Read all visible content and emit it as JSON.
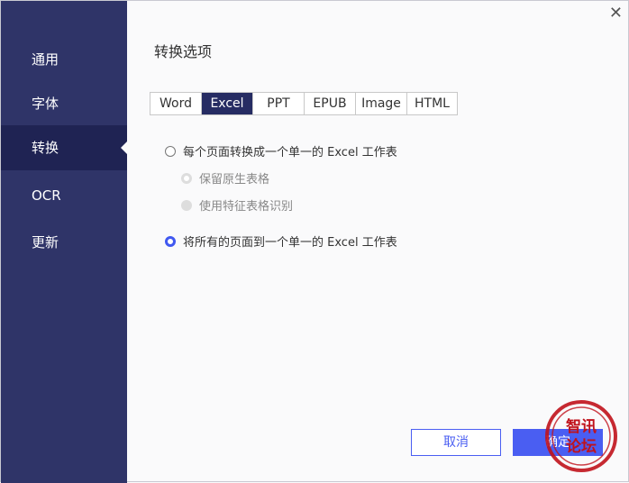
{
  "sidebar": {
    "items": [
      {
        "label": "通用"
      },
      {
        "label": "字体"
      },
      {
        "label": "转换",
        "active": true
      },
      {
        "label": "OCR"
      },
      {
        "label": "更新"
      }
    ]
  },
  "header": {
    "title": "转换选项",
    "close_icon": "close-icon"
  },
  "tabs": [
    {
      "label": "Word"
    },
    {
      "label": "Excel",
      "active": true
    },
    {
      "label": "PPT"
    },
    {
      "label": "EPUB"
    },
    {
      "label": "Image"
    },
    {
      "label": "HTML"
    }
  ],
  "options": {
    "each_page": {
      "label": "每个页面转换成一个单一的 Excel 工作表",
      "selected": false
    },
    "keep_native": {
      "label": "保留原生表格",
      "disabled": true
    },
    "feature_recog": {
      "label": "使用特征表格识别",
      "disabled": true
    },
    "all_pages": {
      "label": "将所有的页面到一个单一的 Excel 工作表",
      "selected": true
    }
  },
  "buttons": {
    "cancel": "取消",
    "ok": "确定"
  },
  "watermark": {
    "text": "智讯论坛"
  },
  "colors": {
    "sidebar": "#2f3468",
    "accent": "#4a5ef2",
    "active_tab": "#262c63",
    "stamp": "#c0121b"
  }
}
